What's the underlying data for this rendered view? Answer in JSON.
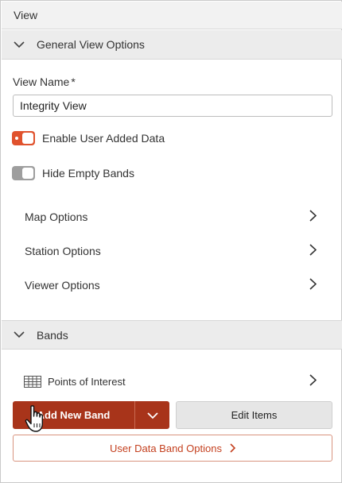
{
  "panel": {
    "title": "View"
  },
  "general": {
    "header": "General View Options",
    "view_name_label": "View Name",
    "required_mark": "*",
    "view_name_value": "Integrity View",
    "toggles": [
      {
        "label": "Enable User Added Data",
        "state": "on"
      },
      {
        "label": "Hide Empty Bands",
        "state": "off"
      }
    ],
    "nav_items": [
      {
        "label": "Map Options"
      },
      {
        "label": "Station Options"
      },
      {
        "label": "Viewer Options"
      }
    ]
  },
  "bands": {
    "header": "Bands",
    "items": [
      {
        "label": "Points of Interest",
        "icon": "table-icon"
      }
    ],
    "add_button_label": "Add New Band",
    "edit_button_label": "Edit Items",
    "options_button_label": "User Data Band Options"
  },
  "colors": {
    "accent": "#a8341a",
    "toggle_on": "#e0522d",
    "toggle_off": "#9e9e9e",
    "outline_text": "#c4401f"
  }
}
